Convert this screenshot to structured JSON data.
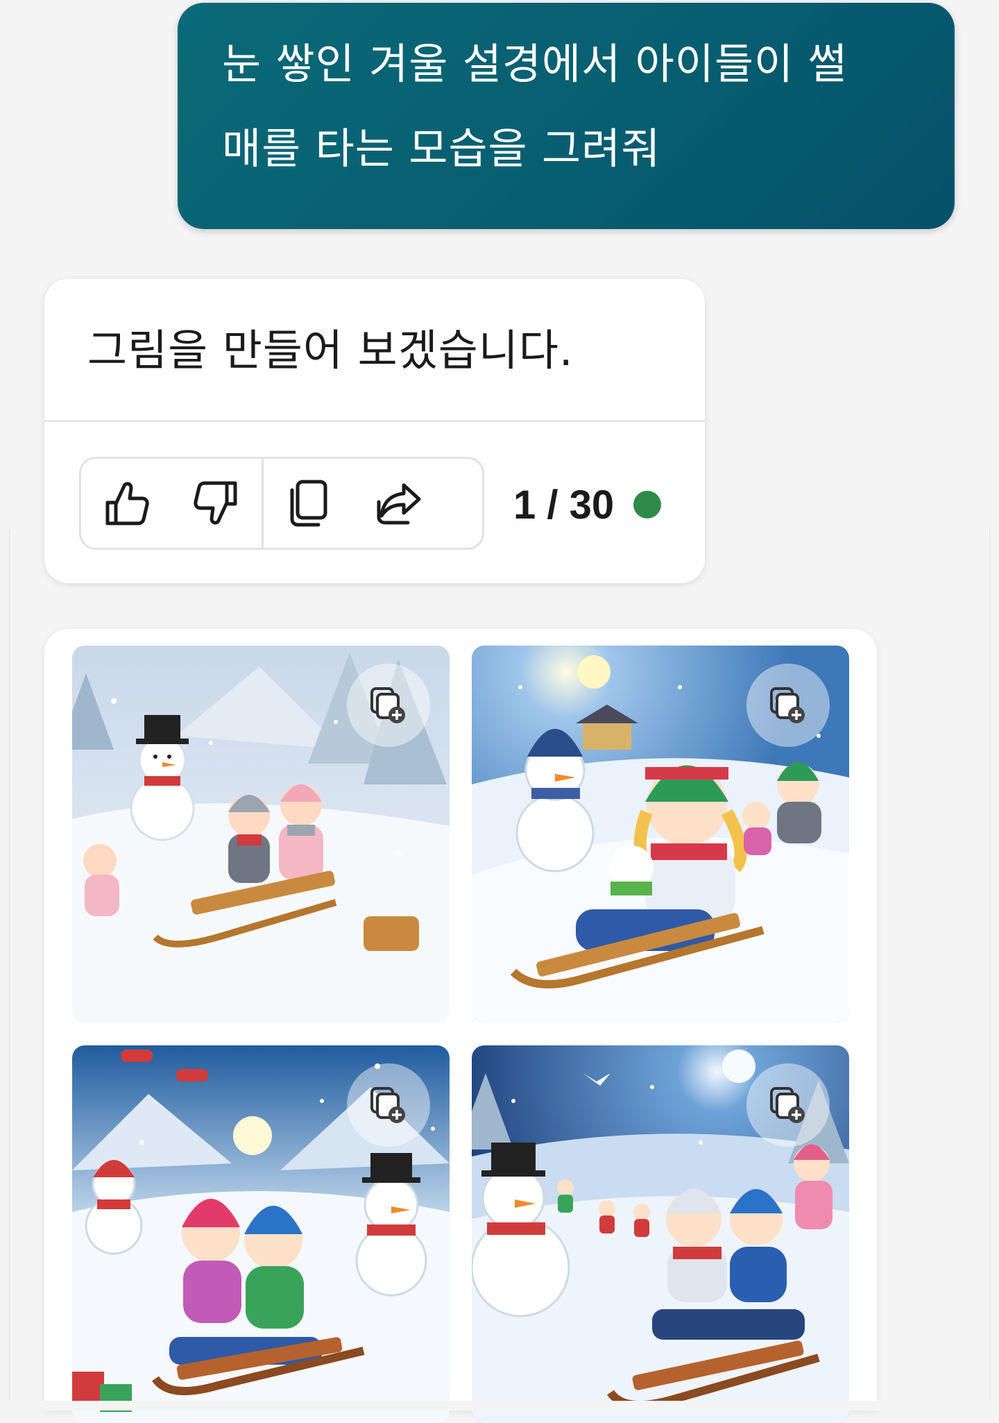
{
  "user_prompt": {
    "line1": "눈 쌓인 겨울 설경에서 아이들이 썰",
    "line2": "매를 타는 모습을 그려줘"
  },
  "bot_response": {
    "text": "그림을 만들어 보겠습니다.",
    "counter": "1 / 30",
    "status_color": "#2e8b47",
    "actions": [
      {
        "name": "like",
        "icon": "thumbs-up-icon"
      },
      {
        "name": "dislike",
        "icon": "thumbs-down-icon"
      },
      {
        "name": "copy",
        "icon": "copy-icon"
      },
      {
        "name": "share",
        "icon": "share-icon"
      }
    ]
  },
  "images": {
    "count": 4,
    "tile_action_icon": "add-to-collection-icon",
    "tiles": [
      {
        "scene": "children-sledding-snowmen-forest"
      },
      {
        "scene": "girl-sledding-with-snowman-sunny"
      },
      {
        "scene": "kids-sledding-helicopter-mountains"
      },
      {
        "scene": "kids-sledding-moonlit-village"
      }
    ]
  },
  "colors": {
    "prompt_bubble": "#075e70",
    "background": "#f4f4f4",
    "card": "#ffffff"
  }
}
